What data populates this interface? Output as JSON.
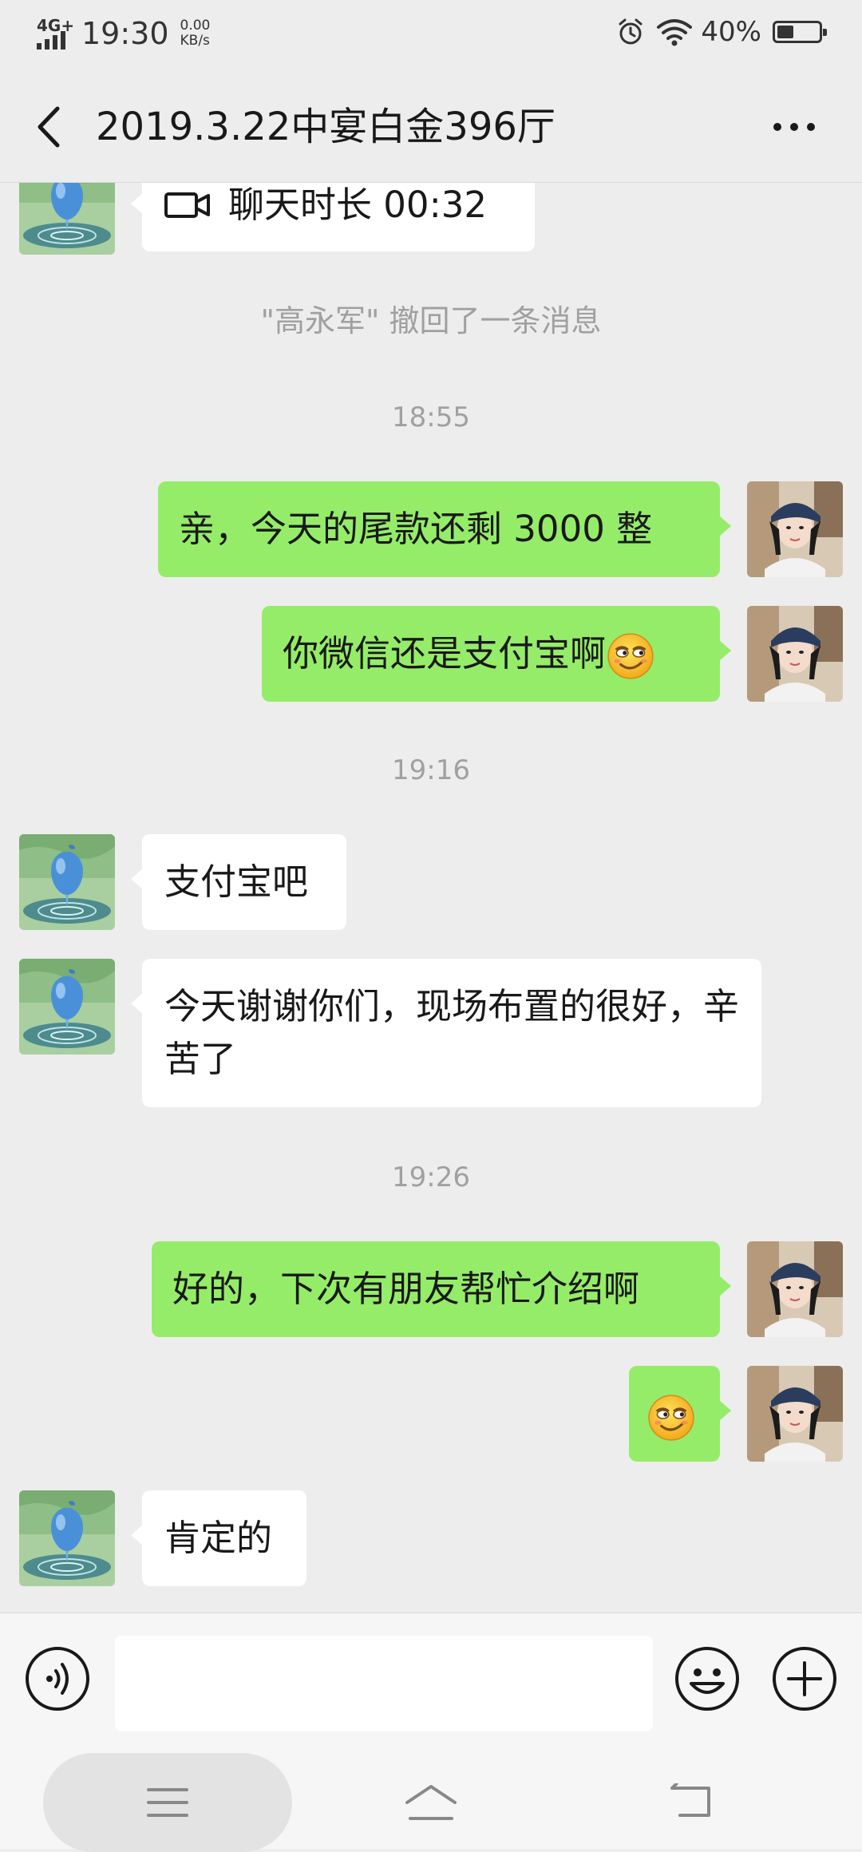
{
  "status_bar": {
    "network": "4G+",
    "time": "19:30",
    "speed_value": "0.00",
    "speed_unit": "KB/s",
    "battery": "40%",
    "battery_level": 0.4
  },
  "header": {
    "title": "2019.3.22中宴白金396厅"
  },
  "messages": {
    "m0": {
      "icon": "video-call-icon",
      "text": "聊天时长 00:32"
    },
    "recall": "\"高永军\" 撤回了一条消息",
    "ts1": "18:55",
    "m1": "亲，今天的尾款还剩 3000 整",
    "m2": "你微信还是支付宝啊",
    "ts2": "19:16",
    "m3": "支付宝吧",
    "m4": "今天谢谢你们，现场布置的很好，辛苦了",
    "ts3": "19:26",
    "m5": "好的，下次有朋友帮忙介绍啊",
    "m6_emoji": "smirk-emoji",
    "m7": "肯定的"
  },
  "input": {
    "value": "",
    "placeholder": ""
  },
  "colors": {
    "background": "#ededed",
    "outgoing_bubble": "#95ec69",
    "incoming_bubble": "#ffffff",
    "meta_text": "#a0a0a0"
  },
  "icons": [
    "back-arrow-icon",
    "more-icon",
    "voice-icon",
    "emoji-icon",
    "plus-icon",
    "nav-menu-icon",
    "nav-home-icon",
    "nav-back-icon"
  ]
}
